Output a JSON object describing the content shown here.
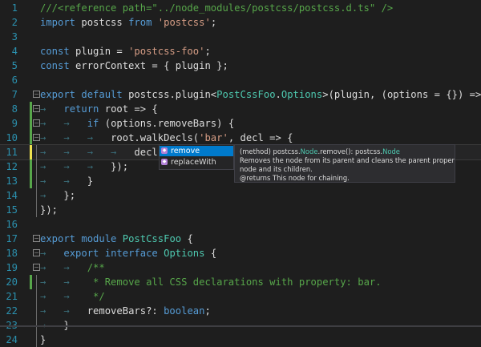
{
  "editor": {
    "lines": [
      {
        "n": "1",
        "tokens": [
          {
            "c": "t-cm",
            "t": "///<reference path=\"../node_modules/postcss/postcss.d.ts\" />"
          }
        ]
      },
      {
        "n": "2",
        "tokens": [
          {
            "c": "t-kw",
            "t": "import"
          },
          {
            "c": "t-txt",
            "t": " postcss "
          },
          {
            "c": "t-kw",
            "t": "from"
          },
          {
            "c": "t-txt",
            "t": " "
          },
          {
            "c": "t-str",
            "t": "'postcss'"
          },
          {
            "c": "t-txt",
            "t": ";"
          }
        ]
      },
      {
        "n": "3",
        "tokens": []
      },
      {
        "n": "4",
        "tokens": [
          {
            "c": "t-kw",
            "t": "const"
          },
          {
            "c": "t-txt",
            "t": " plugin = "
          },
          {
            "c": "t-str",
            "t": "'postcss-foo'"
          },
          {
            "c": "t-txt",
            "t": ";"
          }
        ]
      },
      {
        "n": "5",
        "tokens": [
          {
            "c": "t-kw",
            "t": "const"
          },
          {
            "c": "t-txt",
            "t": " errorContext = { plugin };"
          }
        ]
      },
      {
        "n": "6",
        "tokens": []
      },
      {
        "n": "7",
        "fold": "box",
        "tokens": [
          {
            "c": "t-kw",
            "t": "export"
          },
          {
            "c": "t-txt",
            "t": " "
          },
          {
            "c": "t-kw",
            "t": "default"
          },
          {
            "c": "t-txt",
            "t": " postcss.plugin<"
          },
          {
            "c": "t-type",
            "t": "PostCssFoo"
          },
          {
            "c": "t-txt",
            "t": "."
          },
          {
            "c": "t-type",
            "t": "Options"
          },
          {
            "c": "t-txt",
            "t": ">(plugin, (options = {}) => {"
          }
        ]
      },
      {
        "n": "8",
        "fold": "box",
        "mod": "#57a64a",
        "tokens": [
          {
            "c": "t-ws",
            "t": "→   "
          },
          {
            "c": "t-kw",
            "t": "return"
          },
          {
            "c": "t-txt",
            "t": " root => {"
          }
        ]
      },
      {
        "n": "9",
        "fold": "box",
        "mod": "#57a64a",
        "tokens": [
          {
            "c": "t-ws",
            "t": "→   →   "
          },
          {
            "c": "t-kw",
            "t": "if"
          },
          {
            "c": "t-txt",
            "t": " (options.removeBars) {"
          }
        ]
      },
      {
        "n": "10",
        "fold": "box",
        "mod": "#57a64a",
        "tokens": [
          {
            "c": "t-ws",
            "t": "→   →   →   "
          },
          {
            "c": "t-txt",
            "t": "root.walkDecls("
          },
          {
            "c": "t-str",
            "t": "'bar'"
          },
          {
            "c": "t-txt",
            "t": ", decl => {"
          }
        ]
      },
      {
        "n": "11",
        "fold": "line",
        "mod": "#efe350",
        "current": true,
        "tokens": [
          {
            "c": "t-ws",
            "t": "→   →   →   →   "
          },
          {
            "c": "t-txt",
            "t": "decl.re"
          }
        ]
      },
      {
        "n": "12",
        "fold": "line",
        "mod": "#57a64a",
        "tokens": [
          {
            "c": "t-ws",
            "t": "→   →   →   "
          },
          {
            "c": "t-txt",
            "t": "});"
          }
        ]
      },
      {
        "n": "13",
        "fold": "line",
        "mod": "#57a64a",
        "tokens": [
          {
            "c": "t-ws",
            "t": "→   →   "
          },
          {
            "c": "t-txt",
            "t": "}"
          }
        ]
      },
      {
        "n": "14",
        "fold": "line",
        "tokens": [
          {
            "c": "t-ws",
            "t": "→   "
          },
          {
            "c": "t-txt",
            "t": "};"
          }
        ]
      },
      {
        "n": "15",
        "fold": "line",
        "tokens": [
          {
            "c": "t-txt",
            "t": "});"
          }
        ]
      },
      {
        "n": "16",
        "tokens": []
      },
      {
        "n": "17",
        "fold": "box",
        "tokens": [
          {
            "c": "t-kw",
            "t": "export"
          },
          {
            "c": "t-txt",
            "t": " "
          },
          {
            "c": "t-kw",
            "t": "module"
          },
          {
            "c": "t-txt",
            "t": " "
          },
          {
            "c": "t-type",
            "t": "PostCssFoo"
          },
          {
            "c": "t-txt",
            "t": " {"
          }
        ]
      },
      {
        "n": "18",
        "fold": "box",
        "tokens": [
          {
            "c": "t-ws",
            "t": "→   "
          },
          {
            "c": "t-kw",
            "t": "export"
          },
          {
            "c": "t-txt",
            "t": " "
          },
          {
            "c": "t-kw",
            "t": "interface"
          },
          {
            "c": "t-txt",
            "t": " "
          },
          {
            "c": "t-type",
            "t": "Options"
          },
          {
            "c": "t-txt",
            "t": " {"
          }
        ]
      },
      {
        "n": "19",
        "fold": "box",
        "tokens": [
          {
            "c": "t-ws",
            "t": "→   →   "
          },
          {
            "c": "t-cm",
            "t": "/**"
          }
        ]
      },
      {
        "n": "20",
        "fold": "line",
        "mod": "#57a64a",
        "tokens": [
          {
            "c": "t-ws",
            "t": "→   →   "
          },
          {
            "c": "t-cm",
            "t": " * Remove all CSS declarations with property: bar."
          }
        ]
      },
      {
        "n": "21",
        "fold": "line",
        "tokens": [
          {
            "c": "t-ws",
            "t": "→   →   "
          },
          {
            "c": "t-cm",
            "t": " */"
          }
        ]
      },
      {
        "n": "22",
        "fold": "line",
        "tokens": [
          {
            "c": "t-ws",
            "t": "→   →   "
          },
          {
            "c": "t-txt",
            "t": "removeBars?: "
          },
          {
            "c": "t-kw",
            "t": "boolean"
          },
          {
            "c": "t-txt",
            "t": ";"
          }
        ]
      },
      {
        "n": "23",
        "fold": "line",
        "tokens": [
          {
            "c": "t-ws",
            "t": "→   "
          },
          {
            "c": "t-txt",
            "t": "}"
          }
        ]
      },
      {
        "n": "24",
        "fold": "line",
        "tokens": [
          {
            "c": "t-txt",
            "t": "}"
          }
        ]
      }
    ]
  },
  "completion": {
    "items": [
      {
        "label": "remove",
        "selected": true
      },
      {
        "label": "replaceWith",
        "selected": false
      }
    ]
  },
  "tooltip": {
    "signature_prefix": "(method) postcss.",
    "signature_type": "Node",
    "signature_mid": ".remove(): postcss.",
    "signature_return": "Node",
    "description_1": "Removes the node from its parent and cleans the parent property in the",
    "description_2": "node and its children.",
    "returns": "@returns This node for chaining."
  }
}
